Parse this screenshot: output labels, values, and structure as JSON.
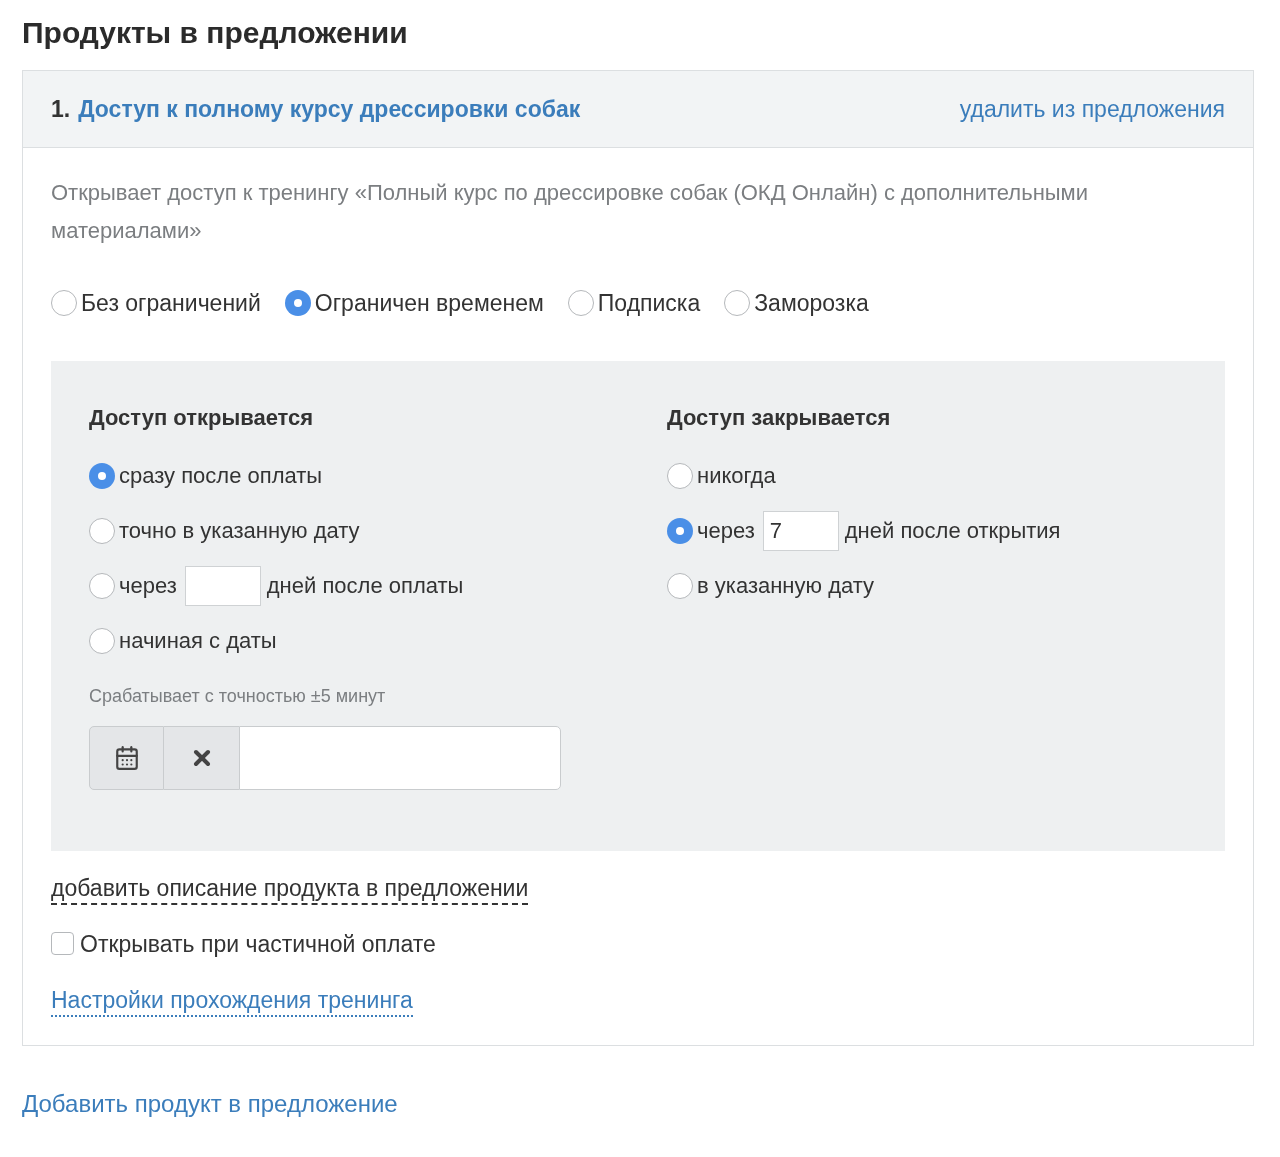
{
  "heading": "Продукты в предложении",
  "product": {
    "number": "1.",
    "title": "Доступ к полному курсу дрессировки собак",
    "remove_link": "удалить из предложения",
    "description": "Открывает доступ к тренингу «Полный курс по дрессировке собак (ОКД Онлайн) с дополнительными материалами»",
    "access_types": [
      {
        "label": "Без ограничений",
        "selected": false
      },
      {
        "label": "Ограничен временем",
        "selected": true
      },
      {
        "label": "Подписка",
        "selected": false
      },
      {
        "label": "Заморозка",
        "selected": false
      }
    ],
    "opens": {
      "title": "Доступ открывается",
      "options": [
        {
          "kind": "plain",
          "label": "сразу после оплаты",
          "selected": true
        },
        {
          "kind": "plain",
          "label": "точно в указанную дату",
          "selected": false
        },
        {
          "kind": "days",
          "label": "через",
          "suffix": "дней после оплаты",
          "selected": false
        },
        {
          "kind": "plain",
          "label": "начиная с даты",
          "selected": false
        }
      ],
      "hint": "Срабатывает с точностью ±5 минут"
    },
    "closes": {
      "title": "Доступ закрывается",
      "options": [
        {
          "kind": "plain",
          "label": "никогда",
          "selected": false
        },
        {
          "kind": "days",
          "label": "через",
          "value": "7",
          "suffix": "дней после открытия",
          "selected": true
        },
        {
          "kind": "plain",
          "label": "в указанную дату",
          "selected": false
        }
      ]
    },
    "add_description_link": "добавить описание продукта в предложении",
    "partial_payment": {
      "label": "Открывать при частичной оплате",
      "checked": false
    },
    "training_settings_link": "Настройки прохождения тренинга"
  },
  "add_product_link": "Добавить продукт в предложение"
}
